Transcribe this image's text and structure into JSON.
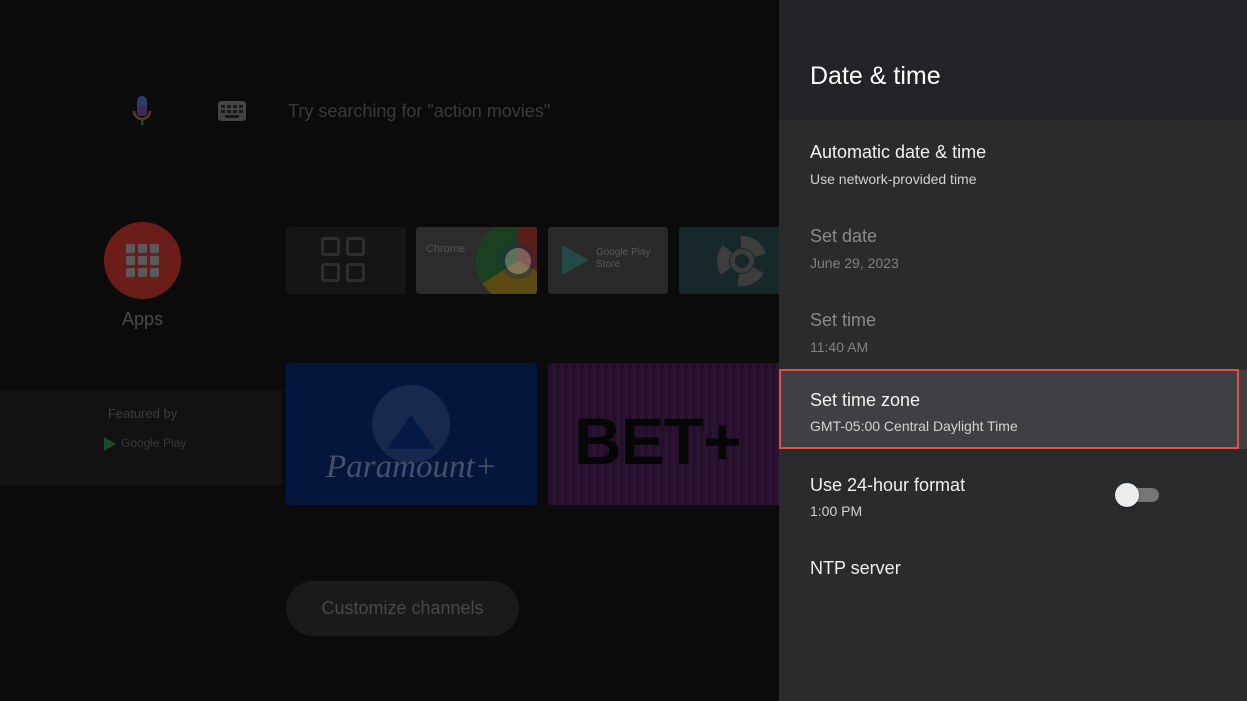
{
  "home": {
    "search_hint": "Try searching for \"action movies\"",
    "apps_label": "Apps",
    "featured_by": "Featured by",
    "featured_provider": "Google Play",
    "tiles": {
      "chrome_label": "Chrome",
      "play_store_label": "Google Play Store",
      "paramount_label": "Paramount+",
      "bet_label": "BET+"
    },
    "customize_label": "Customize channels"
  },
  "panel": {
    "title": "Date & time",
    "items": [
      {
        "title": "Automatic date & time",
        "subtitle": "Use network-provided time",
        "enabled": true
      },
      {
        "title": "Set date",
        "subtitle": "June 29, 2023",
        "enabled": false
      },
      {
        "title": "Set time",
        "subtitle": "11:40 AM",
        "enabled": false
      },
      {
        "title": "Set time zone",
        "subtitle": "GMT-05:00 Central Daylight Time",
        "enabled": true,
        "focused": true
      },
      {
        "title": "Use 24-hour format",
        "subtitle": "1:00 PM",
        "enabled": true,
        "toggle": false
      },
      {
        "title": "NTP server",
        "subtitle": "",
        "enabled": true
      }
    ]
  },
  "colors": {
    "focus_ring": "#e84d47",
    "panel_bg": "#2a2b2d",
    "panel_header_bg": "#232427"
  }
}
